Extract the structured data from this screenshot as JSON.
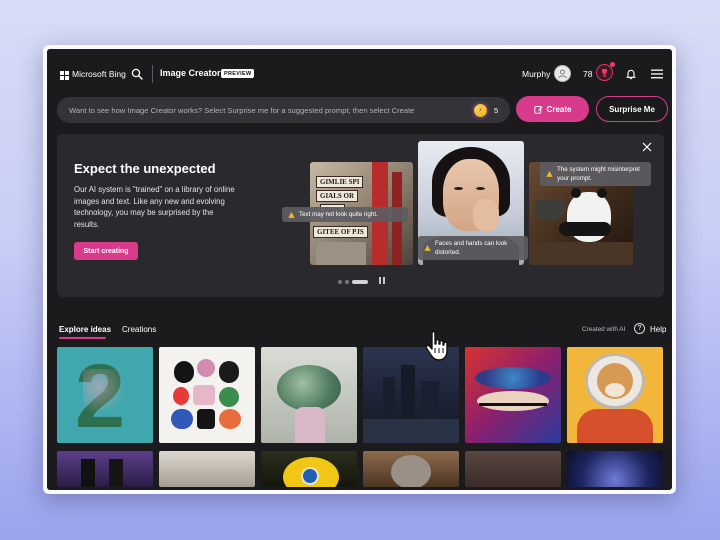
{
  "header": {
    "brand": "Microsoft Bing",
    "app_title": "Image Creator",
    "badge": "PREVIEW",
    "user_name": "Murphy",
    "points": "78",
    "icons": {
      "search": "search-icon",
      "avatar": "user-avatar-icon",
      "rewards": "trophy-icon",
      "notifications": "bell-icon",
      "menu": "hamburger-menu-icon"
    }
  },
  "prompt": {
    "placeholder": "Want to see how Image Creator works? Select Surprise me for a suggested prompt, then select Create",
    "boost_count": "5",
    "create_label": "Create",
    "surprise_label": "Surprise Me"
  },
  "hero": {
    "title": "Expect the unexpected",
    "body": "Our AI system is \"trained\" on a library of online images and text. Like any new and evolving technology, you may be surprised by the results.",
    "cta_label": "Start creating",
    "tips": [
      "Text may not look quite right.",
      "Faces and hands can look distorted.",
      "The system might misinterpret your prompt."
    ],
    "signs": [
      "GIMLIE SPI",
      "GIALS OR",
      "PIOE",
      "GITEE OF PJS"
    ],
    "carousel_slides": 3,
    "carousel_active": 3
  },
  "tabs": {
    "explore": "Explore ideas",
    "creations": "Creations",
    "created_with": "Created with AI",
    "help": "Help"
  },
  "gallery": {
    "tile_1_text": "2"
  },
  "colors": {
    "accent": "#d83b8b",
    "background": "#1b1a1d",
    "panel": "#2a292d",
    "prompt_bar": "#343338"
  }
}
